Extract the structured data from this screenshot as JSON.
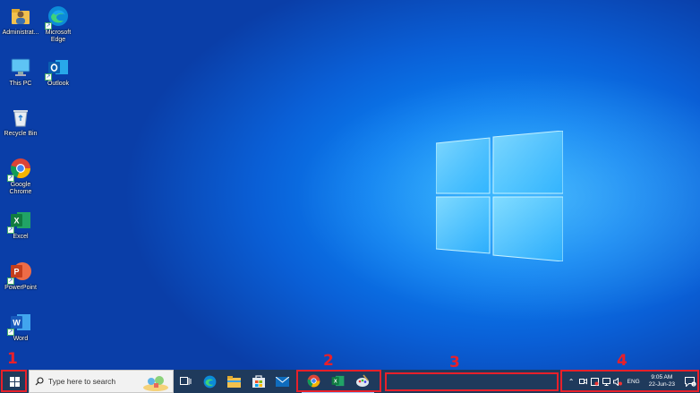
{
  "desktop": {
    "icons": [
      {
        "label": "Administrat...",
        "icon": "user-folder-icon"
      },
      {
        "label": "Microsoft Edge",
        "icon": "edge-icon"
      },
      {
        "label": "This PC",
        "icon": "this-pc-icon"
      },
      {
        "label": "Outlook",
        "icon": "outlook-icon"
      },
      {
        "label": "Recycle Bin",
        "icon": "recycle-bin-icon"
      },
      {
        "label": "Google Chrome",
        "icon": "chrome-icon"
      },
      {
        "label": "Excel",
        "icon": "excel-icon"
      },
      {
        "label": "PowerPoint",
        "icon": "powerpoint-icon"
      },
      {
        "label": "Word",
        "icon": "word-icon"
      }
    ]
  },
  "taskbar": {
    "search_placeholder": "Type here to search",
    "pinned": [
      "task-view-icon",
      "edge-icon",
      "file-explorer-icon",
      "store-icon",
      "mail-icon"
    ],
    "running": [
      "chrome-icon",
      "excel-icon",
      "paint-icon"
    ],
    "language": "ENG",
    "time": "9:05 AM",
    "date": "22-Jun-23"
  },
  "annotations": [
    "1",
    "2",
    "3",
    "4"
  ],
  "colors": {
    "annotation": "#e8202a",
    "taskbar": "#1f3a5c",
    "desktop": "#0b7ef0"
  }
}
